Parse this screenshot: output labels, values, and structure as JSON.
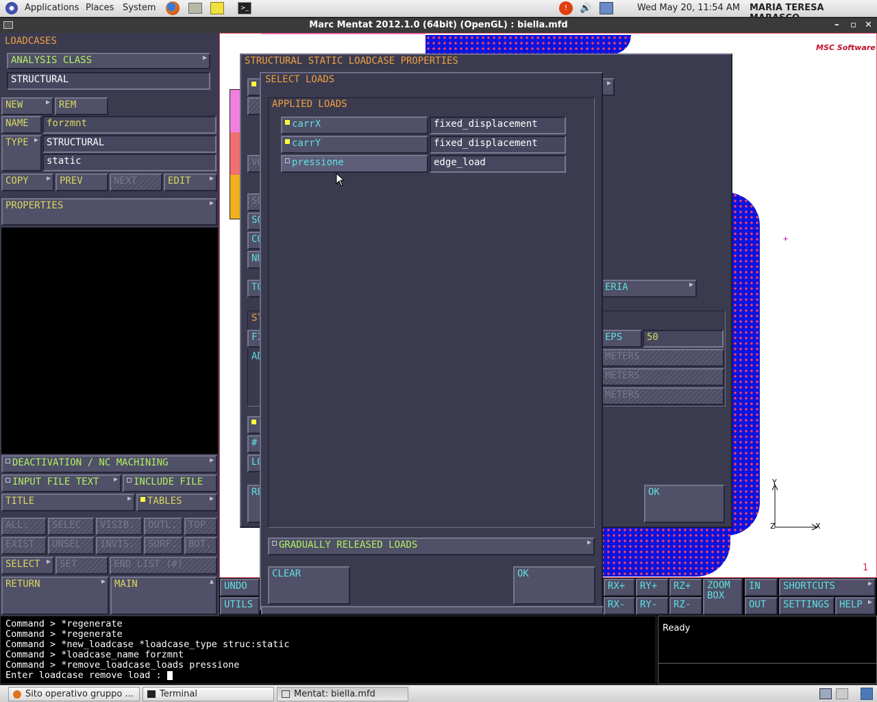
{
  "topbar": {
    "applications": "Applications",
    "places": "Places",
    "system": "System",
    "datetime": "Wed May 20, 11:54 AM",
    "user": "MARIA TERESA MARASCO"
  },
  "window": {
    "title": "Marc Mentat 2012.1.0 (64bit) (OpenGL) : biella.mfd"
  },
  "left": {
    "loadcases": "LOADCASES",
    "analysis_class": "ANALYSIS CLASS",
    "analysis_class_value": "STRUCTURAL",
    "new": "NEW",
    "rem": "REM",
    "name_label": "NAME",
    "name_value": "forzmnt",
    "type_label": "TYPE",
    "type_value1": "STRUCTURAL",
    "type_value2": "static",
    "copy": "COPY",
    "prev": "PREV",
    "next": "NEXT",
    "edit": "EDIT",
    "properties": "PROPERTIES",
    "deactivation": "DEACTIVATION / NC MACHINING",
    "input_file_text": "INPUT FILE TEXT",
    "include_file": "INCLUDE FILE",
    "title": "TITLE",
    "tables": "TABLES",
    "sel_grid": [
      "ALL:",
      "SELEC",
      "VISIB.",
      "OUTL.",
      "TOP",
      "EXIST",
      "UNSEL",
      "INVIS.",
      "SURF.",
      "BOT."
    ],
    "select": "SELECT",
    "set": "SET",
    "end_list": "END LIST (#)",
    "return": "RETURN",
    "main": "MAIN"
  },
  "bg_dialog": {
    "title": "STRUCTURAL STATIC LOADCASE PROPERTIES",
    "eria": "ERIA",
    "eps": "EPS",
    "eps_value": "50",
    "meters": [
      "METERS",
      "METERS",
      "METERS"
    ],
    "ok": "OK",
    "frag": [
      "SO",
      "CO",
      "NU",
      "TO",
      "ST",
      "FI",
      "AD",
      "#",
      "LO",
      "RE",
      "VO",
      "SU"
    ]
  },
  "select_loads": {
    "title": "SELECT LOADS",
    "applied_loads": "APPLIED LOADS",
    "loads": [
      {
        "name": "carrX",
        "type": "fixed_displacement",
        "checked": true
      },
      {
        "name": "carrY",
        "type": "fixed_displacement",
        "checked": true
      },
      {
        "name": "pressione",
        "type": "edge_load",
        "checked": false
      }
    ],
    "gradually": "GRADUALLY RELEASED LOADS",
    "clear": "CLEAR",
    "ok": "OK"
  },
  "bottom": {
    "undo": "UNDO",
    "utils": "UTILS",
    "rxp": "RX+",
    "rxm": "RX-",
    "ryp": "RY+",
    "rym": "RY-",
    "rzp": "RZ+",
    "rzm": "RZ-",
    "zoom": "ZOOM",
    "box": "BOX",
    "in": "IN",
    "out": "OUT",
    "shortcuts": "SHORTCUTS",
    "settings": "SETTINGS",
    "help": "HELP"
  },
  "viewport": {
    "logo": "MSC Software",
    "axis_x": "X",
    "axis_y": "Y",
    "axis_z": "Z",
    "viewport_no": "1"
  },
  "command": {
    "lines": [
      "Command > *regenerate",
      "Command > *regenerate",
      "Command > *new_loadcase *loadcase_type struc:static",
      "Command > *loadcase_name forzmnt",
      "Command > *remove_loadcase_loads pressione",
      "Enter loadcase remove load : "
    ]
  },
  "status": {
    "text": "Ready"
  },
  "taskbar": {
    "items": [
      "Sito operativo gruppo ...",
      "Terminal",
      "Mentat: biella.mfd"
    ]
  },
  "colors": {
    "panel": "#3b3b4f",
    "yellow_text": "#d8d860",
    "orange_text": "#f0a040",
    "cyan_text": "#5fe0e0",
    "mesh": "#0a14e0"
  }
}
